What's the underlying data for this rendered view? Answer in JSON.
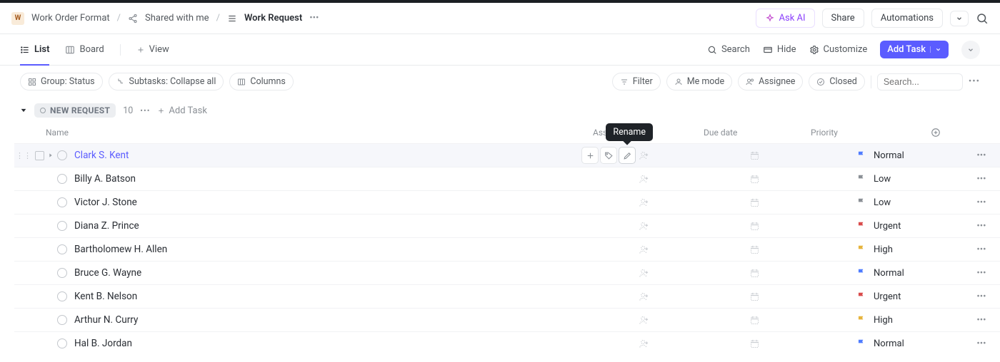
{
  "breadcrumbs": {
    "doc_initial": "W",
    "workspace": "Work Order Format",
    "shared": "Shared with me",
    "current": "Work Request"
  },
  "header_actions": {
    "ask_ai": "Ask AI",
    "share": "Share",
    "automations": "Automations"
  },
  "views": {
    "list": "List",
    "board": "Board",
    "add_view": "View",
    "search": "Search",
    "hide": "Hide",
    "customize": "Customize",
    "add_task": "Add Task"
  },
  "toolbar": {
    "group": "Group: Status",
    "subtasks": "Subtasks: Collapse all",
    "columns_btn": "Columns",
    "filter": "Filter",
    "me_mode": "Me mode",
    "assignee": "Assignee",
    "closed": "Closed",
    "search_placeholder": "Search..."
  },
  "group_header": {
    "name": "NEW REQUEST",
    "count": "10",
    "add_task": "Add Task"
  },
  "tooltip": {
    "rename": "Rename"
  },
  "columns": {
    "name": "Name",
    "assignee": "Assignee",
    "due": "Due date",
    "priority": "Priority"
  },
  "priority_colors": {
    "Normal": "#4f7cff",
    "Low": "#8a8f95",
    "Urgent": "#d94b4b",
    "High": "#e6b43c"
  },
  "tasks": [
    {
      "name": "Clark S. Kent",
      "priority": "Normal"
    },
    {
      "name": "Billy A. Batson",
      "priority": "Low"
    },
    {
      "name": "Victor J. Stone",
      "priority": "Low"
    },
    {
      "name": "Diana Z. Prince",
      "priority": "Urgent"
    },
    {
      "name": "Bartholomew H. Allen",
      "priority": "High"
    },
    {
      "name": "Bruce G. Wayne",
      "priority": "Normal"
    },
    {
      "name": "Kent B. Nelson",
      "priority": "Urgent"
    },
    {
      "name": "Arthur N. Curry",
      "priority": "High"
    },
    {
      "name": "Hal B. Jordan",
      "priority": "Normal"
    }
  ]
}
